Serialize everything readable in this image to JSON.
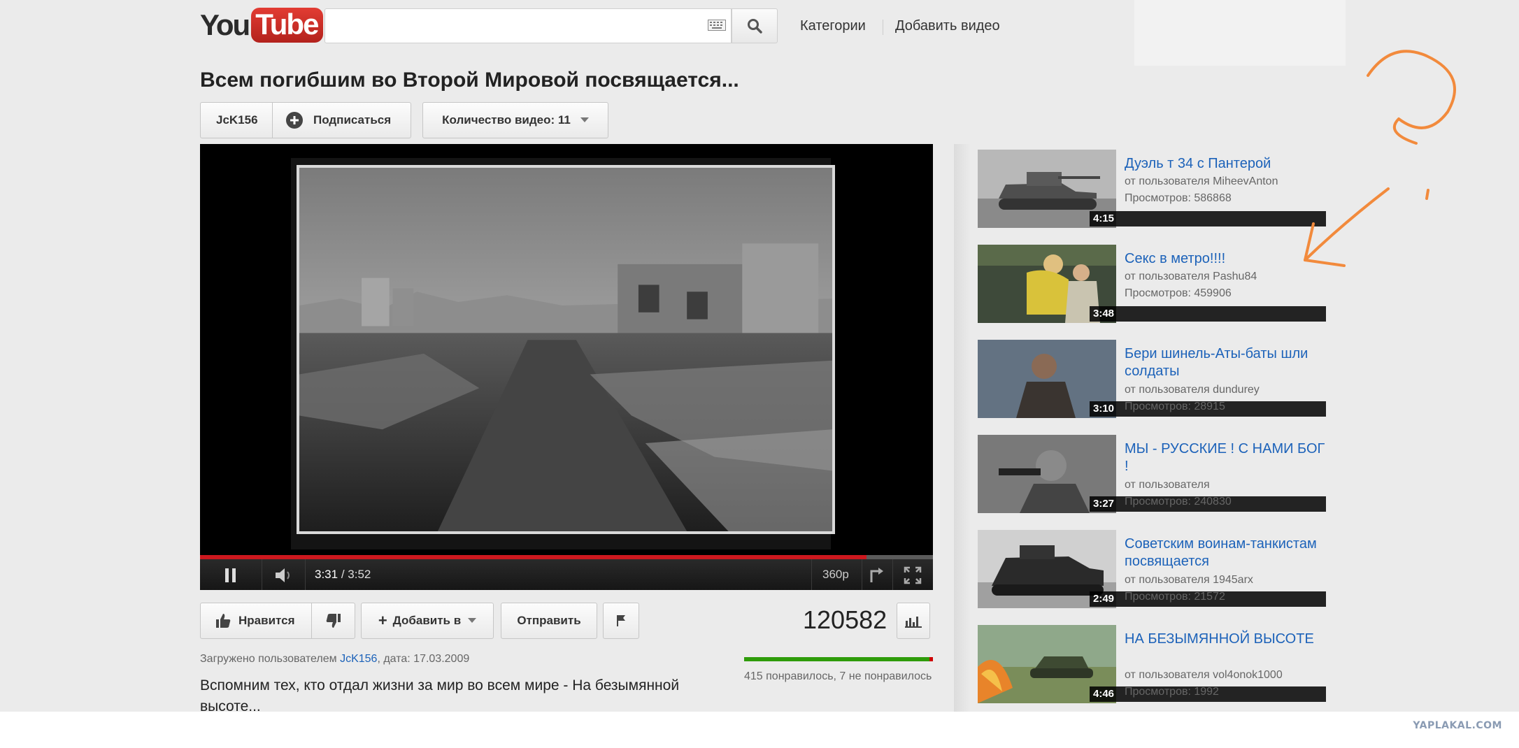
{
  "header": {
    "logo_you": "You",
    "logo_tube": "Tube",
    "search_placeholder": "",
    "nav_categories": "Категории",
    "nav_upload": "Добавить видео"
  },
  "video": {
    "title": "Всем погибшим во Второй Мировой посвящается...",
    "channel": "JcK156",
    "subscribe_label": "Подписаться",
    "video_count_label": "Количество видео: 11",
    "current_time": "3:31",
    "duration": "/ 3:52",
    "quality": "360p",
    "progress_fraction": 0.909
  },
  "actions": {
    "like_label": "Нравится",
    "add_to_label": "Добавить в",
    "share_label": "Отправить",
    "view_count": "120582",
    "likes_text": "415 понравилось, 7 не понравилось",
    "like_ratio": 0.983
  },
  "details": {
    "uploaded_prefix": "Загружено пользователем ",
    "uploader": "JcK156",
    "uploaded_date": ", дата: 17.03.2009",
    "description": "Вспомним тех, кто отдал жизни за мир во всем мире - На безымянной высоте..."
  },
  "related": [
    {
      "title": "Дуэль т 34 с Пантерой",
      "author": "от пользователя MiheevAnton",
      "views": "Просмотров: 586868",
      "duration": "4:15"
    },
    {
      "title": "Секс в метро!!!!",
      "author": "от пользователя Pashu84",
      "views": "Просмотров: 459906",
      "duration": "3:48"
    },
    {
      "title": "Бери шинель-Аты-баты шли солдаты",
      "author": "от пользователя dundurey",
      "views": "Просмотров: 28915",
      "duration": "3:10"
    },
    {
      "title": "МЫ - РУССКИЕ ! С НАМИ БОГ !",
      "author": "от пользователя",
      "views": "Просмотров: 240830",
      "duration": "3:27"
    },
    {
      "title": "Советским воинам-танкистам посвящается",
      "author": "от пользователя 1945arx",
      "views": "Просмотров: 21572",
      "duration": "2:49"
    },
    {
      "title": "НА БЕЗЫМЯННОЙ ВЫСОТЕ",
      "author": "от пользователя vol4onok1000",
      "views": "Просмотров: 1992",
      "duration": "4:46"
    }
  ],
  "watermark": "YAPLAKAL.COM",
  "colors": {
    "brand_red": "#cc181e",
    "link_blue": "#1c62b9",
    "like_green": "#2f9c0a",
    "annotation_orange": "#f28a3c"
  }
}
